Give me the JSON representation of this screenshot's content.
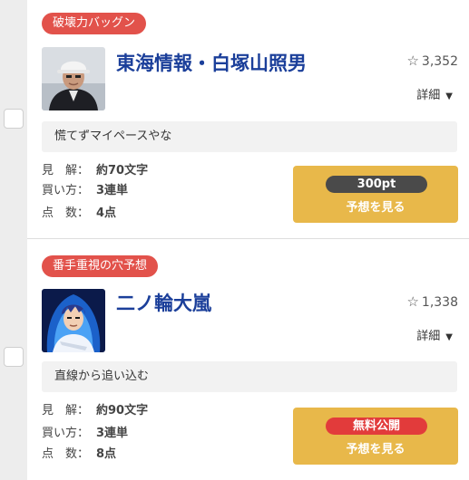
{
  "predictions": [
    {
      "badge": "破壊力バッグン",
      "name": "東海情報・白塚山照男",
      "favorites": "3,352",
      "detail_label": "詳細",
      "comment": "慌てずマイペースやな",
      "specs": [
        {
          "label": "見　解：",
          "value": "約70文字"
        },
        {
          "label": "買い方：",
          "value": "3連単"
        },
        {
          "label": "点　数：",
          "value": "4点"
        }
      ],
      "price": "300pt",
      "price_style": "dark",
      "button_label": "予想を見る",
      "avatar_icon": "man-with-cap-portrait-icon"
    },
    {
      "badge": "番手重視の穴予想",
      "name": "二ノ輪大嵐",
      "favorites": "1,338",
      "detail_label": "詳細",
      "comment": "直線から追い込む",
      "specs": [
        {
          "label": "見　解：",
          "value": "約90文字"
        },
        {
          "label": "買い方：",
          "value": "3連単"
        },
        {
          "label": "点　数：",
          "value": "8点"
        }
      ],
      "price": "無料公開",
      "price_style": "red",
      "button_label": "予想を見る",
      "avatar_icon": "anime-character-blue-flame-icon"
    }
  ],
  "colors": {
    "badge": "#e2524b",
    "name": "#1b3f9a",
    "button": "#e8b84a",
    "price_dark": "#4a4a4a",
    "price_red": "#e23b3b"
  }
}
